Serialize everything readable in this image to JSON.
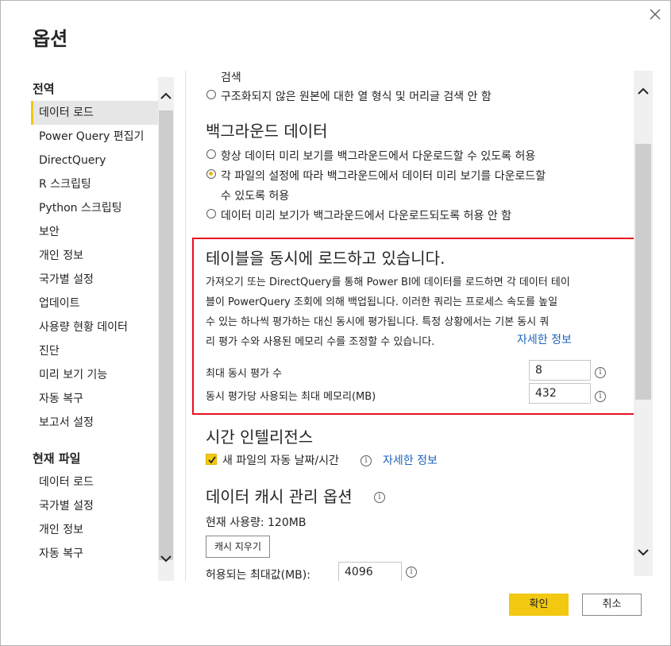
{
  "dialog": {
    "title": "옵션",
    "close_icon": "close-icon"
  },
  "nav": {
    "global_section": "전역",
    "global_items": [
      {
        "label": "데이터 로드",
        "active": true
      },
      {
        "label": "Power Query 편집기"
      },
      {
        "label": "DirectQuery"
      },
      {
        "label": "R 스크립팅"
      },
      {
        "label": "Python 스크립팅"
      },
      {
        "label": "보안"
      },
      {
        "label": "개인 정보"
      },
      {
        "label": "국가별 설정"
      },
      {
        "label": "업데이트"
      },
      {
        "label": "사용량 현황 데이터"
      },
      {
        "label": "진단"
      },
      {
        "label": "미리 보기 기능"
      },
      {
        "label": "자동 복구"
      },
      {
        "label": "보고서 설정"
      }
    ],
    "file_section": "현재 파일",
    "file_items": [
      {
        "label": "데이터 로드"
      },
      {
        "label": "국가별 설정"
      },
      {
        "label": "개인 정보"
      },
      {
        "label": "자동 복구"
      }
    ]
  },
  "main": {
    "search_partial": "검색",
    "search_no_detect": "구조화되지 않은 원본에 대한 열 형식 및 머리글 검색 안 함",
    "background": {
      "heading": "백그라운드 데이터",
      "options": [
        "항상 데이터 미리 보기를 백그라운드에서 다운로드할 수 있도록 허용",
        "각 파일의 설정에 따라 백그라운드에서 데이터 미리 보기를 다운로드할",
        "수 있도록 허용",
        "데이터 미리 보기가 백그라운드에서 다운로드되도록 허용 안 함"
      ]
    },
    "parallel": {
      "heading": "테이블을 동시에 로드하고 있습니다.",
      "desc_lines": [
        "가져오기 또는 DirectQuery를 통해 Power BI에 데이터를 로드하면 각 데이터 테이",
        "블이 PowerQuery 조회에 의해 백업됩니다. 이러한 쿼리는 프로세스 속도를 높일",
        "수 있는 하나씩 평가하는 대신 동시에 평가됩니다. 특정 상황에서는 기본 동시 쿼",
        "리 평가 수와 사용된 메모리 수를 조정할 수 있습니다."
      ],
      "learn_more": "자세한 정보",
      "max_eval_label": "최대 동시 평가 수",
      "max_eval_value": "8",
      "max_mem_label": "동시 평가당 사용되는 최대 메모리(MB)",
      "max_mem_value": "432"
    },
    "time_intel": {
      "heading": "시간 인텔리전스",
      "checkbox_label": "새 파일의 자동 날짜/시간",
      "learn_more": "자세한 정보"
    },
    "cache": {
      "heading": "데이터 캐시 관리 옵션",
      "current_usage": "현재 사용량: 120MB",
      "clear_button": "캐시 지우기",
      "max_allowed_label": "허용되는 최대값(MB):",
      "max_allowed_value": "4096"
    }
  },
  "footer": {
    "ok": "확인",
    "cancel": "취소"
  },
  "colors": {
    "accent": "#f2c811",
    "highlight_border": "#e81123",
    "link": "#1e63b8"
  }
}
